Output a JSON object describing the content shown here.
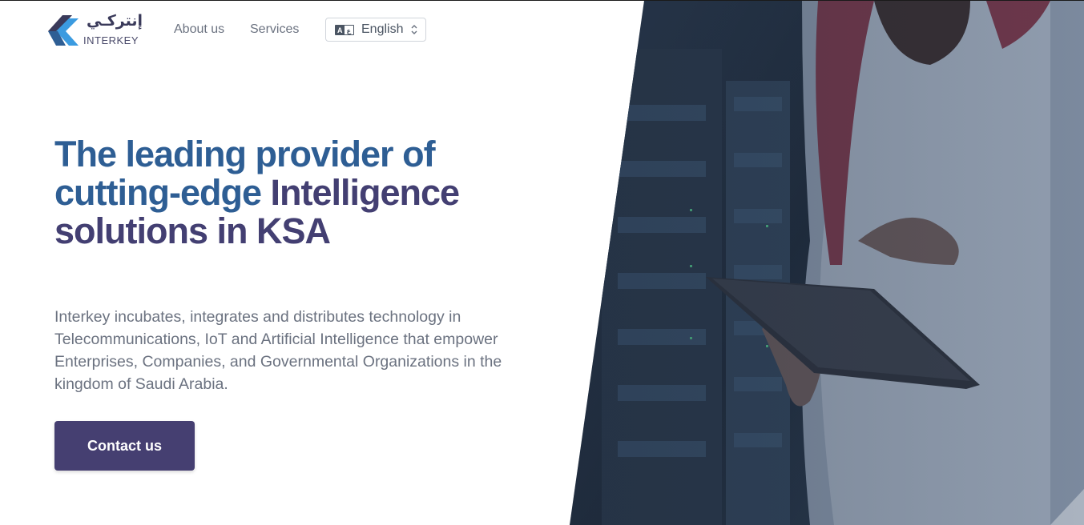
{
  "header": {
    "logo": {
      "arabic": "إنتركـي",
      "latin": "INTERKEY"
    },
    "nav": [
      {
        "label": "About us"
      },
      {
        "label": "Services"
      }
    ],
    "language": {
      "selected": "English",
      "icon": "translate-icon"
    }
  },
  "hero": {
    "headline_line1": "The leading provider of cutting-edge",
    "headline_line2": "Intelligence solutions in KSA",
    "intro": "Interkey incubates, integrates and distributes technology in Telecommunications, IoT and Artificial Intelligence that empower Enterprises, Companies, and Governmental Organizations in the kingdom of Saudi Arabia.",
    "cta_label": "Contact us"
  },
  "colors": {
    "headline_blue": "#2e5e94",
    "headline_purple": "#433f72",
    "button": "#453f71",
    "body_text": "#6b7280",
    "logo_light_blue": "#3b9be0",
    "logo_dark": "#3a3a5a"
  }
}
